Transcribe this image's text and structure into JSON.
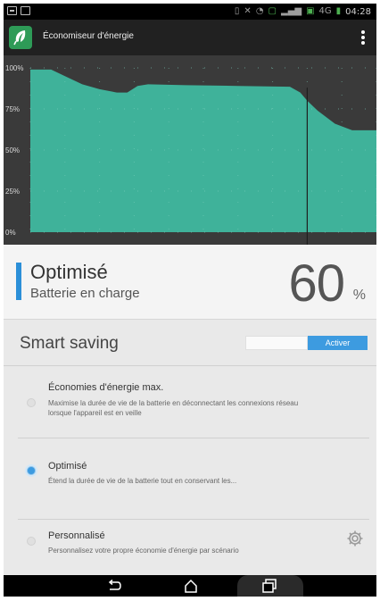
{
  "app": {
    "title": "Économiseur d'énergie",
    "logo_icon": "leaf-icon"
  },
  "status_bar": {
    "time": "04:28",
    "signal_text": "4G"
  },
  "chart_data": {
    "type": "area",
    "title": "",
    "xlabel": "",
    "ylabel": "",
    "y_tick_labels": [
      "100%",
      "75%",
      "50%",
      "25%",
      "0%"
    ],
    "ylim": [
      0,
      100
    ],
    "x_range": [
      0,
      100
    ],
    "series": [
      {
        "color": "#3fb29a",
        "points": [
          [
            0,
            99
          ],
          [
            6,
            99
          ],
          [
            10,
            95
          ],
          [
            15,
            90
          ],
          [
            20,
            87
          ],
          [
            25,
            85
          ],
          [
            28,
            85
          ],
          [
            31,
            89
          ],
          [
            34,
            90
          ],
          [
            45,
            89.5
          ],
          [
            60,
            89
          ],
          [
            75,
            88.5
          ],
          [
            78,
            85
          ],
          [
            80,
            80
          ],
          [
            83,
            74
          ],
          [
            88,
            66
          ],
          [
            93,
            62
          ],
          [
            100,
            62
          ]
        ]
      }
    ],
    "marker_x": 80,
    "grid": true,
    "background": "#3a3a3a"
  },
  "status": {
    "title": "Optimisé",
    "subtitle": "Batterie en charge",
    "battery_value": "60",
    "battery_unit": "%",
    "accent_color": "#2b8fd8"
  },
  "smart_saving": {
    "label": "Smart saving",
    "toggle_label": "Activer",
    "enabled": true
  },
  "options": [
    {
      "title": "Économies d'énergie max.",
      "description": "Maximise la durée de vie de la batterie en déconnectant les connexions réseau lorsque l'appareil est en veille",
      "selected": false
    },
    {
      "title": "Optimisé",
      "description": "Étend la durée de vie de la batterie tout en conservant les...",
      "selected": true
    },
    {
      "title": "Personnalisé",
      "description": "Personnalisez votre propre économie d'énergie par scénario",
      "selected": false
    }
  ],
  "navbar": {
    "back_icon": "back-icon",
    "home_icon": "home-icon",
    "recents_icon": "recents-icon"
  }
}
